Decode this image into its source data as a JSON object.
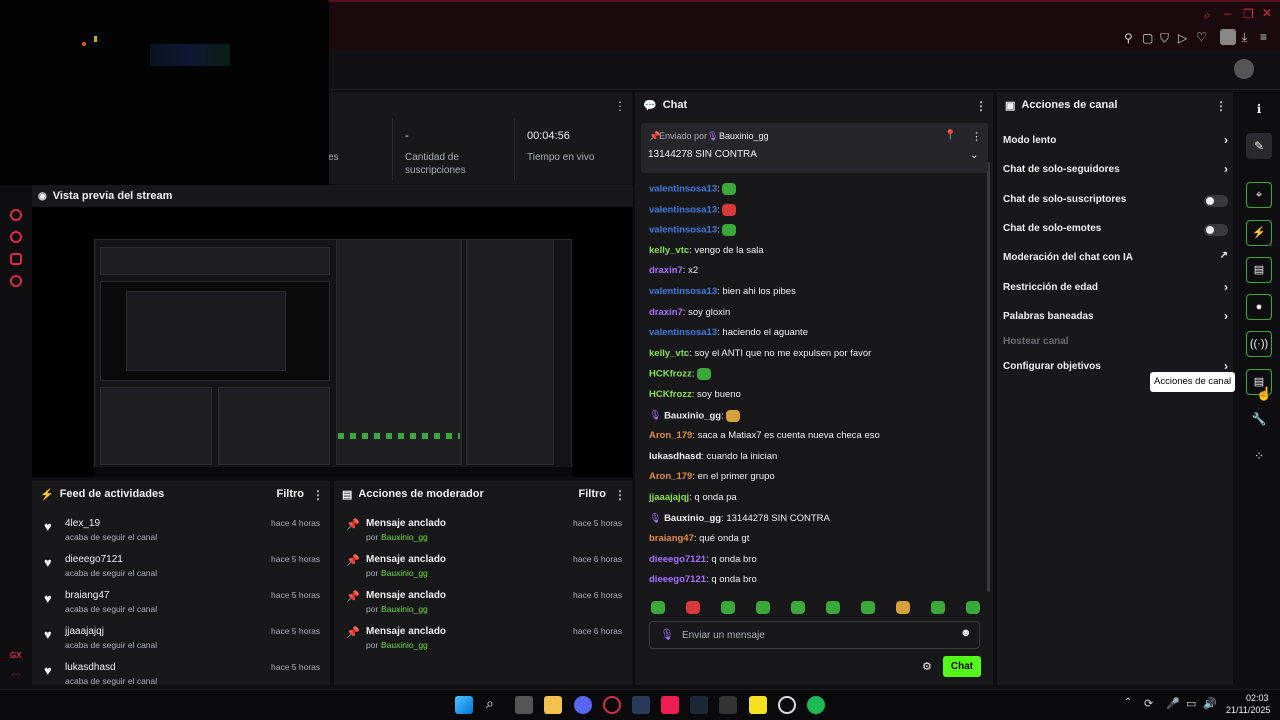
{
  "stats": {
    "frag_label": "es",
    "subs_value": "-",
    "subs_label_1": "Cantidad de",
    "subs_label_2": "suscripciones",
    "live_value": "00:04:56",
    "live_label": "Tiempo en vivo"
  },
  "preview": {
    "title": "Vista previa del stream"
  },
  "feed": {
    "title": "Feed de actividades",
    "filter": "Filtro",
    "items": [
      {
        "user": "4lex_19",
        "action": "acaba de seguir el canal",
        "time": "hace 4 horas"
      },
      {
        "user": "dieeego7121",
        "action": "acaba de seguir el canal",
        "time": "hace 5 horas"
      },
      {
        "user": "braiang47",
        "action": "acaba de seguir el canal",
        "time": "hace 5 horas"
      },
      {
        "user": "jjaaajajqj",
        "action": "acaba de seguir el canal",
        "time": "hace 5 horas"
      },
      {
        "user": "lukasdhasd",
        "action": "acaba de seguir el canal",
        "time": "hace 5 horas"
      }
    ]
  },
  "modactions": {
    "title": "Acciones de moderador",
    "filter": "Filtro",
    "items": [
      {
        "title": "Mensaje anclado",
        "by": "por",
        "user": "Bauxinio_gg",
        "time": "hace 5 horas"
      },
      {
        "title": "Mensaje anclado",
        "by": "por",
        "user": "Bauxinio_gg",
        "time": "hace 6 horas"
      },
      {
        "title": "Mensaje anclado",
        "by": "por",
        "user": "Bauxinio_gg",
        "time": "hace 6 horas"
      },
      {
        "title": "Mensaje anclado",
        "by": "por",
        "user": "Bauxinio_gg",
        "time": "hace 6 horas"
      }
    ]
  },
  "chat": {
    "title": "Chat",
    "pinned_by": "Enviado por",
    "pinned_user": "Bauxinio_gg",
    "pinned_text": "13144278 SIN CONTRA",
    "input_placeholder": "Enviar un mensaje",
    "send_label": "Chat",
    "messages": [
      {
        "user": "valentinsosa13",
        "text": "",
        "color": "#3d7be0"
      },
      {
        "user": "valentinsosa13",
        "text": "",
        "color": "#3d7be0"
      },
      {
        "user": "valentinsosa13",
        "text": "",
        "color": "#3d7be0"
      },
      {
        "user": "kelly_vtc",
        "text": "vengo de la sala",
        "color": "#8be04e"
      },
      {
        "user": "draxin7",
        "text": "x2",
        "color": "#a970ff"
      },
      {
        "user": "valentinsosa13",
        "text": "bien ahi los pibes",
        "color": "#3d7be0"
      },
      {
        "user": "draxin7",
        "text": "soy gloxin",
        "color": "#a970ff"
      },
      {
        "user": "valentinsosa13",
        "text": "haciendo el aguante",
        "color": "#3d7be0"
      },
      {
        "user": "kelly_vtc",
        "text": "soy el ANTI que no me expulsen por favor",
        "color": "#8be04e"
      },
      {
        "user": "HCKfrozz",
        "text": "",
        "color": "#8be04e"
      },
      {
        "user": "HCKfrozz",
        "text": "soy bueno",
        "color": "#8be04e"
      },
      {
        "user": "Bauxinio_gg",
        "text": "",
        "color": "#efeff1"
      },
      {
        "user": "Aron_179",
        "text": "saca a Matiax7 es cuenta nueva checa eso",
        "color": "#e08a3d"
      },
      {
        "user": "lukasdhasd",
        "text": "cuando la inician",
        "color": "#efeff1"
      },
      {
        "user": "Aron_179",
        "text": "en el primer grupo",
        "color": "#e08a3d"
      },
      {
        "user": "jjaaajajqj",
        "text": "q onda pa",
        "color": "#8be04e"
      },
      {
        "user": "Bauxinio_gg",
        "text": "13144278 SIN CONTRA",
        "color": "#efeff1"
      },
      {
        "user": "braiang47",
        "text": "qué onda gt",
        "color": "#e08a3d"
      },
      {
        "user": "dieeego7121",
        "text": "q onda bro",
        "color": "#a970ff"
      },
      {
        "user": "dieeego7121",
        "text": "q onda bro",
        "color": "#a970ff"
      }
    ]
  },
  "actions": {
    "title": "Acciones de canal",
    "items": [
      {
        "label": "Modo lento",
        "kind": "chevron"
      },
      {
        "label": "Chat de solo-seguidores",
        "kind": "chevron"
      },
      {
        "label": "Chat de solo-suscriptores",
        "kind": "toggle"
      },
      {
        "label": "Chat de solo-emotes",
        "kind": "toggle"
      },
      {
        "label": "Moderación del chat con IA",
        "kind": "external"
      },
      {
        "label": "Restricción de edad",
        "kind": "chevron"
      },
      {
        "label": "Palabras baneadas",
        "kind": "chevron"
      },
      {
        "label": "Hostear canal",
        "kind": "disabled"
      },
      {
        "label": "Configurar objetivos",
        "kind": "chevron"
      }
    ],
    "tooltip": "Acciones de canal"
  },
  "taskbar": {
    "time": "02:03",
    "date": "21/11/2025"
  },
  "colors": {
    "accent_green": "#53fc18",
    "panel_bg": "#18181b",
    "brand_red": "#d62d4a"
  }
}
